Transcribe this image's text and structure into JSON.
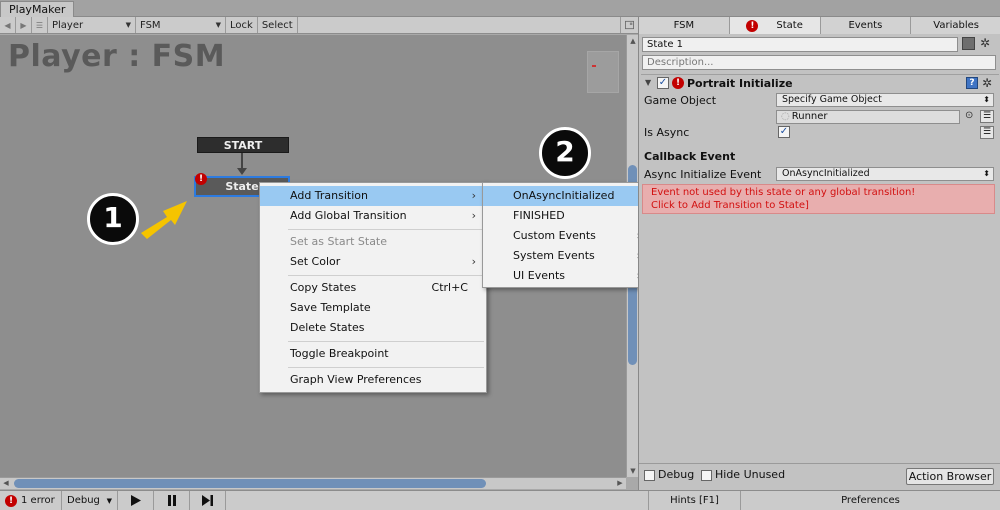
{
  "window": {
    "tab_label": "PlayMaker"
  },
  "toolbar": {
    "back_icon": "back-arrow-icon",
    "forward_icon": "forward-arrow-icon",
    "menu_icon": "hamburger-menu-icon",
    "gameobject_select": "Player",
    "fsm_select": "FSM",
    "lock_label": "Lock",
    "select_label": "Select"
  },
  "graph": {
    "title": "Player : FSM",
    "start_node_label": "START",
    "state_node_label": "State",
    "state_error_glyph": "!",
    "selection_color": "#2d7be0"
  },
  "annotations": {
    "badge_1": "1",
    "badge_2": "2",
    "arrow_color": "#f5c400"
  },
  "context_menu": {
    "items": [
      {
        "label": "Add Transition",
        "submenu": true,
        "highlighted": true
      },
      {
        "label": "Add Global Transition",
        "submenu": true
      },
      {
        "label": "Set as Start State",
        "disabled": true
      },
      {
        "label": "Set Color",
        "submenu": true
      },
      {
        "label": "Copy States",
        "shortcut": "Ctrl+C"
      },
      {
        "label": "Save Template"
      },
      {
        "label": "Delete States"
      },
      {
        "label": "Toggle Breakpoint"
      },
      {
        "label": "Graph View Preferences"
      }
    ]
  },
  "sub_menu": {
    "items": [
      {
        "label": "OnAsyncInitialized",
        "highlighted": true
      },
      {
        "label": "FINISHED"
      },
      {
        "label": "Custom Events",
        "submenu": true
      },
      {
        "label": "System Events",
        "submenu": true
      },
      {
        "label": "UI Events",
        "submenu": true
      }
    ]
  },
  "bottombar": {
    "error_count": "1 error",
    "debug_select": "Debug",
    "hints_label": "Hints [F1]",
    "preferences_label": "Preferences"
  },
  "inspector": {
    "tabs": [
      "FSM",
      "State",
      "Events",
      "Variables"
    ],
    "state_name": "State 1",
    "description_placeholder": "Description...",
    "action": {
      "title": "Portrait Initialize",
      "game_object_label": "Game Object",
      "game_object_mode": "Specify Game Object",
      "game_object_value": "Runner",
      "is_async_label": "Is Async",
      "callback_section": "Callback Event",
      "async_event_label": "Async Initialize Event",
      "async_event_value": "OnAsyncInitialized",
      "error_line1": "Event not used by this state or any global transition!",
      "error_line2": "Click to Add Transition to State]"
    },
    "debug_label": "Debug",
    "hide_unused_label": "Hide Unused",
    "action_browser_label": "Action Browser"
  }
}
